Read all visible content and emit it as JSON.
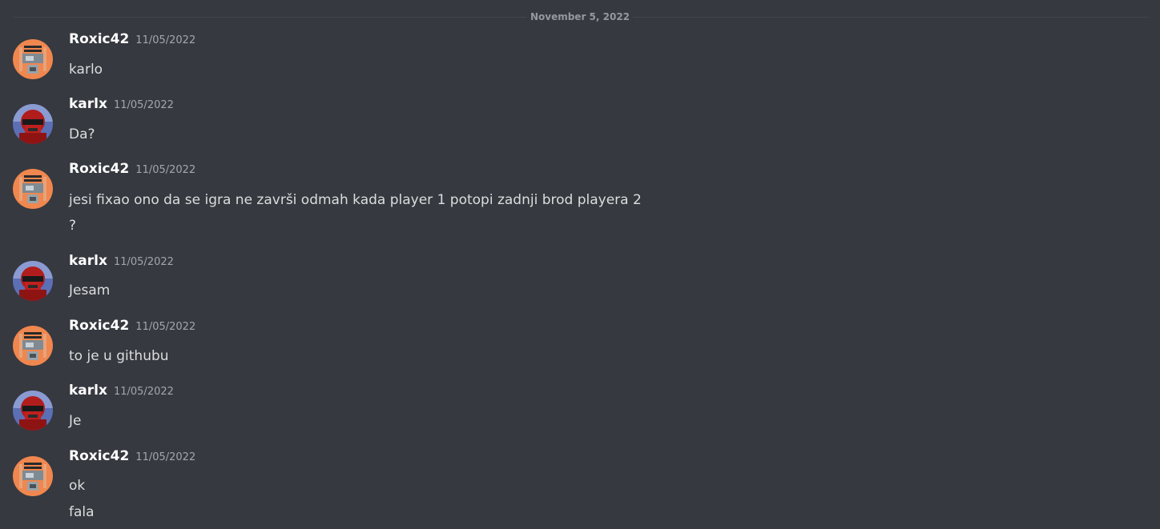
{
  "date_divider": "November 5, 2022",
  "colors": {
    "background": "#36393f",
    "username": "#ffffff",
    "message_text": "#dcddde",
    "timestamp": "#a3a6aa",
    "roxic_avatar_bg": "#f0874f",
    "karlx_avatar_bg": "#5b6fb5"
  },
  "messages": [
    {
      "author": "Roxic42",
      "avatar": "roxic-avatar-icon",
      "timestamp": "11/05/2022",
      "lines": [
        "karlo"
      ]
    },
    {
      "author": "karlx",
      "avatar": "karlx-avatar-icon",
      "timestamp": "11/05/2022",
      "lines": [
        "Da?"
      ]
    },
    {
      "author": "Roxic42",
      "avatar": "roxic-avatar-icon",
      "timestamp": "11/05/2022",
      "lines": [
        "jesi fixao ono da se igra ne završi odmah kada player 1 potopi zadnji brod playera 2",
        "?"
      ]
    },
    {
      "author": "karlx",
      "avatar": "karlx-avatar-icon",
      "timestamp": "11/05/2022",
      "lines": [
        "Jesam"
      ]
    },
    {
      "author": "Roxic42",
      "avatar": "roxic-avatar-icon",
      "timestamp": "11/05/2022",
      "lines": [
        "to je u githubu"
      ]
    },
    {
      "author": "karlx",
      "avatar": "karlx-avatar-icon",
      "timestamp": "11/05/2022",
      "lines": [
        "Je"
      ]
    },
    {
      "author": "Roxic42",
      "avatar": "roxic-avatar-icon",
      "timestamp": "11/05/2022",
      "lines": [
        "ok",
        "fala"
      ]
    }
  ]
}
